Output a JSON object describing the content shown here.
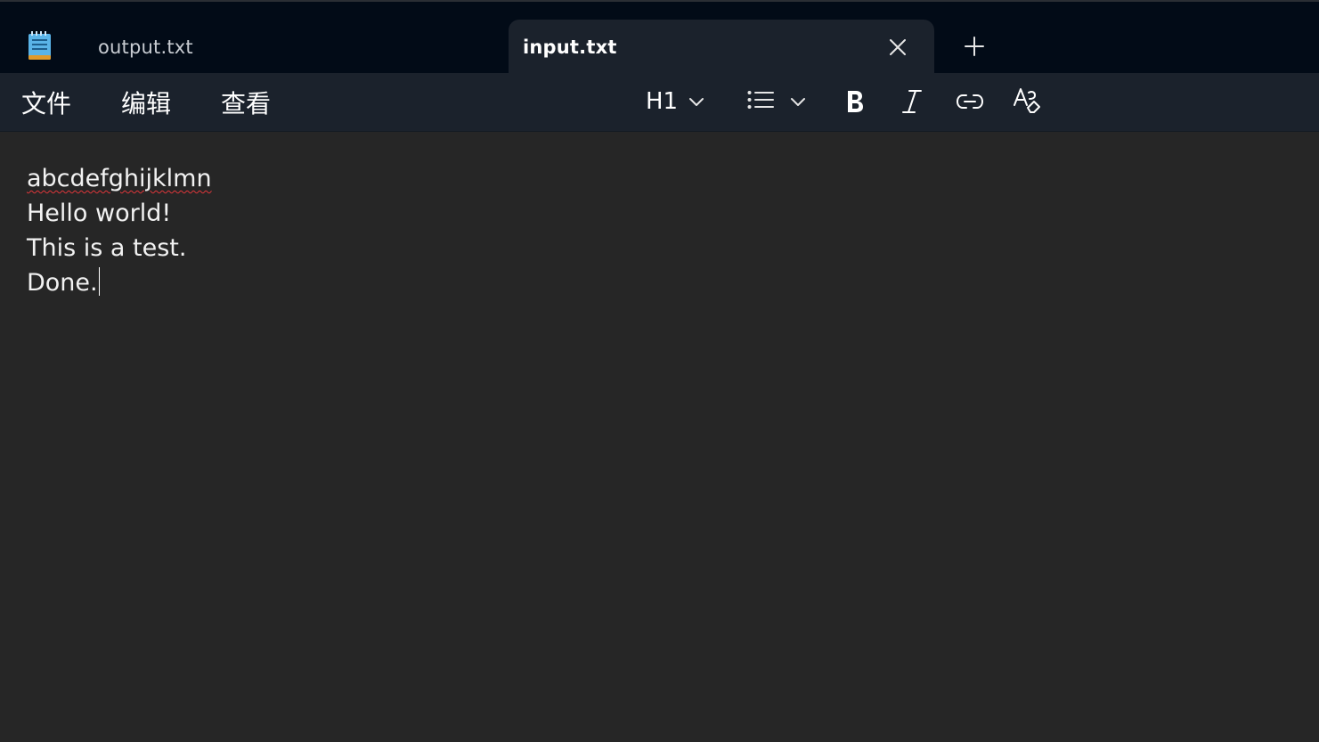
{
  "app": {
    "icon": "notepad-icon",
    "accent": "#4aa3df"
  },
  "tabs": [
    {
      "label": "output.txt",
      "active": false
    },
    {
      "label": "input.txt",
      "active": true
    }
  ],
  "tab_controls": {
    "close_icon": "close-icon",
    "new_tab_icon": "plus-icon"
  },
  "menu": {
    "file": "文件",
    "edit": "编辑",
    "view": "查看"
  },
  "toolbar": {
    "heading": {
      "label": "H1",
      "icon": "chevron-down-icon"
    },
    "list": {
      "icon": "bulleted-list-icon",
      "dropdown_icon": "chevron-down-icon"
    },
    "bold_icon": "bold-icon",
    "italic_icon": "italic-icon",
    "link_icon": "link-icon",
    "clear_format_icon": "clear-formatting-icon"
  },
  "document": {
    "lines": [
      "abcdefghijklmn",
      "Hello world!",
      "This is a test.",
      "Done."
    ],
    "misspelled_line": 0,
    "caret_after_line": 3
  },
  "colors": {
    "titlebar_bg": "#020b17",
    "toolbar_bg": "#1b222c",
    "editor_bg": "#262626",
    "spellcheck": "#e0363a"
  }
}
